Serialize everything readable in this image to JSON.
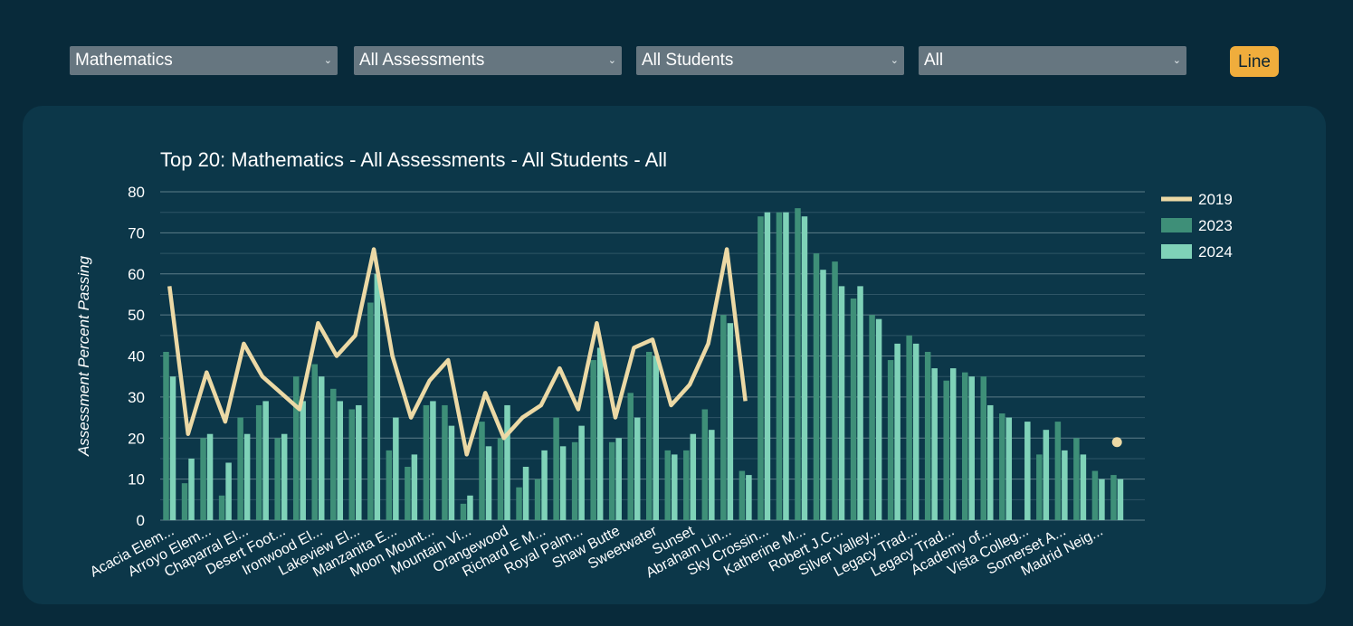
{
  "filters": {
    "subject": "Mathematics",
    "assessment": "All Assessments",
    "student_group": "All Students",
    "grade": "All",
    "chart_type_button": "Line",
    "chevron_icon": "chevron-down-icon"
  },
  "colors": {
    "background": "#082a3a",
    "panel": "#0c3749",
    "line_2019": "#ecd9a5",
    "bar_2023": "#3e8f78",
    "bar_2024": "#7fd2b8",
    "button": "#f0ad3c"
  },
  "chart_data": {
    "type": "bar",
    "title": "Top 20: Mathematics - All Assessments - All Students - All",
    "ylabel": "Assessment Percent Passing",
    "xlabel": "",
    "ylim": [
      0,
      80
    ],
    "yticks": [
      0,
      10,
      20,
      30,
      40,
      50,
      60,
      70,
      80
    ],
    "grid": true,
    "legend_position": "top-right",
    "x_tick_labels": [
      "Acacia Elem...",
      "Arroyo Elem...",
      "Chaparral El...",
      "Desert Foot...",
      "Ironwood El...",
      "Lakeview El...",
      "Manzanita E...",
      "Moon Mount...",
      "Mountain Vi...",
      "Orangewood",
      "Richard E M...",
      "Royal Palm...",
      "Shaw Butte",
      "Sweetwater",
      "Sunset",
      "Abraham Lin...",
      "Sky Crossin...",
      "Katherine M...",
      "Robert J.C...",
      "Silver Valley...",
      "Legacy Trad...",
      "Legacy Trad...",
      "Academy of...",
      "Vista Colleg...",
      "Somerset A...",
      "Madrid Neig..."
    ],
    "series": [
      {
        "name": "2019",
        "type": "line",
        "values": [
          57,
          21,
          36,
          24,
          43,
          35,
          31,
          27,
          48,
          40,
          45,
          66,
          40,
          25,
          34,
          39,
          16,
          31,
          20,
          25,
          28,
          37,
          27,
          48,
          25,
          42,
          44,
          28,
          33,
          43,
          66,
          29,
          null,
          null,
          null,
          null,
          null,
          null,
          null,
          null,
          null,
          null,
          null,
          null,
          null,
          null,
          null,
          null,
          null,
          null,
          null,
          19,
          null
        ]
      },
      {
        "name": "2023",
        "type": "bar",
        "values": [
          41,
          9,
          20,
          6,
          25,
          28,
          20,
          35,
          38,
          32,
          27,
          53,
          17,
          13,
          28,
          28,
          4,
          24,
          20,
          8,
          10,
          25,
          19,
          39,
          19,
          31,
          41,
          17,
          17,
          27,
          50,
          12,
          74,
          75,
          76,
          65,
          63,
          54,
          50,
          39,
          45,
          41,
          34,
          36,
          35,
          26,
          null,
          16,
          24,
          20,
          12,
          11,
          null
        ]
      },
      {
        "name": "2024",
        "type": "bar",
        "values": [
          35,
          15,
          21,
          14,
          21,
          29,
          21,
          29,
          35,
          29,
          28,
          60,
          25,
          16,
          29,
          23,
          6,
          18,
          28,
          13,
          17,
          18,
          23,
          42,
          20,
          25,
          40,
          16,
          21,
          22,
          48,
          11,
          75,
          75,
          74,
          61,
          57,
          57,
          49,
          43,
          43,
          37,
          37,
          35,
          28,
          25,
          24,
          22,
          17,
          16,
          10,
          10,
          null
        ]
      }
    ],
    "legend": [
      {
        "name": "2019",
        "marker": "line"
      },
      {
        "name": "2023",
        "marker": "box"
      },
      {
        "name": "2024",
        "marker": "box"
      }
    ]
  }
}
